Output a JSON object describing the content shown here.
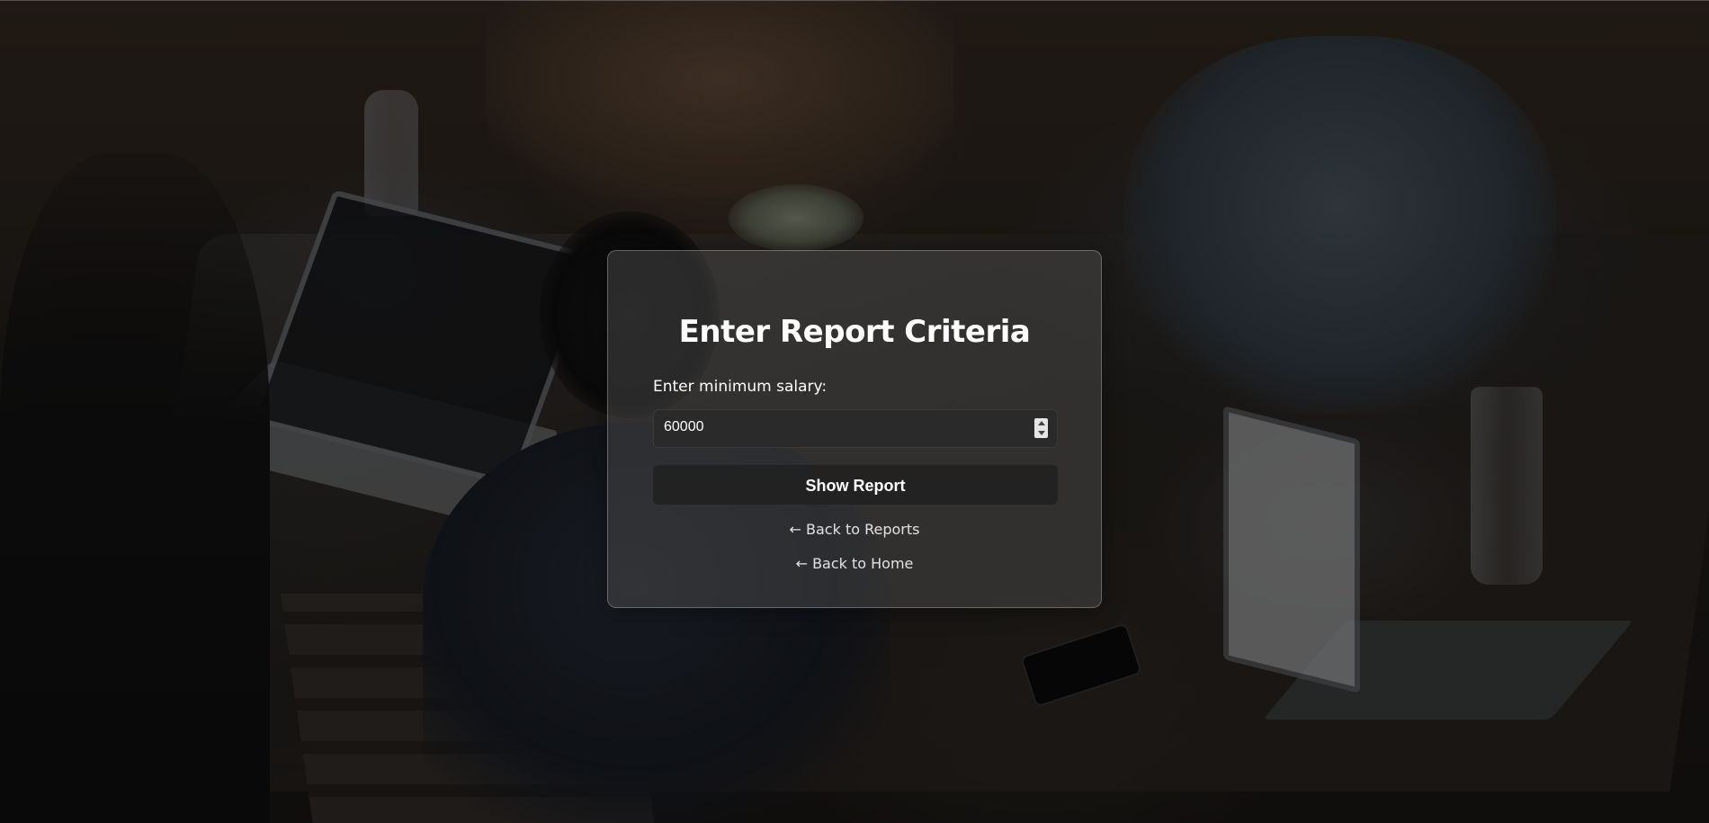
{
  "form": {
    "title": "Enter Report Criteria",
    "salary_label": "Enter minimum salary:",
    "salary_value": "60000",
    "submit_label": "Show Report"
  },
  "links": {
    "back_to_reports": "← Back to Reports",
    "back_to_home": "← Back to Home"
  },
  "colors": {
    "card_background": "#555555",
    "button_background": "#222222",
    "input_background": "#2a2a2a",
    "text": "#ffffff"
  },
  "icons": {
    "spinner": "number-spinner-icon"
  }
}
